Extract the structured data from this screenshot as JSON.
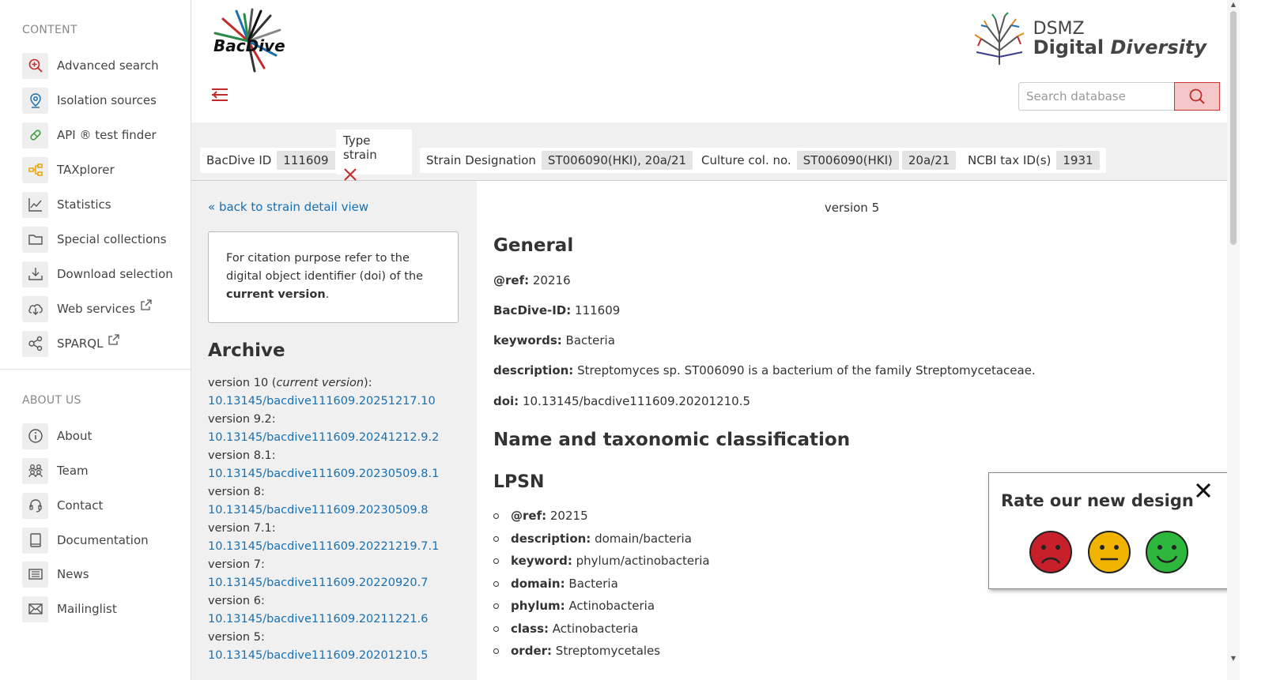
{
  "sidebar": {
    "content_title": "CONTENT",
    "content_items": [
      {
        "label": "Advanced search",
        "icon": "search-plus-icon"
      },
      {
        "label": "Isolation sources",
        "icon": "location-pin-icon"
      },
      {
        "label": "API ® test finder",
        "icon": "test-strip-icon"
      },
      {
        "label": "TAXplorer",
        "icon": "tree-icon"
      },
      {
        "label": "Statistics",
        "icon": "chart-line-icon"
      },
      {
        "label": "Special collections",
        "icon": "folder-icon"
      },
      {
        "label": "Download selection",
        "icon": "download-icon"
      },
      {
        "label": "Web services",
        "icon": "cloud-download-icon"
      },
      {
        "label": "SPARQL",
        "icon": "share-nodes-icon"
      }
    ],
    "about_title": "ABOUT US",
    "about_items": [
      {
        "label": "About",
        "icon": "info-icon"
      },
      {
        "label": "Team",
        "icon": "team-icon"
      },
      {
        "label": "Contact",
        "icon": "headset-icon"
      },
      {
        "label": "Documentation",
        "icon": "book-icon"
      },
      {
        "label": "News",
        "icon": "newspaper-icon"
      },
      {
        "label": "Mailinglist",
        "icon": "envelope-icon"
      }
    ]
  },
  "header": {
    "logo_text": "BacDive",
    "dsmz_line1": "DSMZ",
    "dsmz_line2a": "Digital",
    "dsmz_line2b": "Diversity",
    "search_placeholder": "Search database"
  },
  "infobar": {
    "bacdive_id_label": "BacDive ID",
    "bacdive_id_value": "111609",
    "type_strain_label": "Type strain",
    "strain_designation_label": "Strain Designation",
    "strain_designation_value": "ST006090(HKI), 20a/21",
    "culture_col_label": "Culture col. no.",
    "culture_col_values": [
      "ST006090(HKI)",
      "20a/21"
    ],
    "ncbi_label": "NCBI tax ID(s)",
    "ncbi_value": "1931"
  },
  "leftpanel": {
    "back_link": "« back to strain detail view",
    "cite_line1": "For citation purpose refer to the digital object identifier (doi) of the ",
    "cite_bold": "current version",
    "cite_end": ".",
    "archive_title": "Archive",
    "archive": [
      {
        "version": "version 10 (",
        "current": "current version",
        "suffix": "):",
        "doi": "10.13145/bacdive111609.20251217.10"
      },
      {
        "version": "version 9.2:",
        "doi": "10.13145/bacdive111609.20241212.9.2"
      },
      {
        "version": "version 8.1:",
        "doi": "10.13145/bacdive111609.20230509.8.1"
      },
      {
        "version": "version 8:",
        "doi": "10.13145/bacdive111609.20230509.8"
      },
      {
        "version": "version 7.1:",
        "doi": "10.13145/bacdive111609.20221219.7.1"
      },
      {
        "version": "version 7:",
        "doi": "10.13145/bacdive111609.20220920.7"
      },
      {
        "version": "version 6:",
        "doi": "10.13145/bacdive111609.20211221.6"
      },
      {
        "version": "version 5:",
        "doi": "10.13145/bacdive111609.20201210.5"
      }
    ]
  },
  "main": {
    "version_label": "version 5",
    "general_title": "General",
    "general": [
      {
        "key": "@ref:",
        "value": "20216"
      },
      {
        "key": "BacDive-ID:",
        "value": "111609"
      },
      {
        "key": "keywords:",
        "value": "Bacteria"
      },
      {
        "key": "description:",
        "value": "Streptomyces sp. ST006090 is a bacterium of the family Streptomycetaceae."
      },
      {
        "key": "doi:",
        "value": "10.13145/bacdive111609.20201210.5"
      }
    ],
    "taxonomy_title": "Name and taxonomic classification",
    "lpsn_title": "LPSN",
    "lpsn": [
      {
        "key": "@ref:",
        "value": "20215"
      },
      {
        "key": "description:",
        "value": "domain/bacteria"
      },
      {
        "key": "keyword:",
        "value": "phylum/actinobacteria"
      },
      {
        "key": "domain:",
        "value": "Bacteria"
      },
      {
        "key": "phylum:",
        "value": "Actinobacteria"
      },
      {
        "key": "class:",
        "value": "Actinobacteria"
      },
      {
        "key": "order:",
        "value": "Streptomycetales"
      }
    ]
  },
  "rating": {
    "title": "Rate our new design",
    "colors": {
      "bad": "#c8202a",
      "neutral": "#f0b400",
      "good": "#2db83d"
    }
  },
  "colors": {
    "accent": "#c32a2a",
    "link": "#1a6fb0"
  }
}
